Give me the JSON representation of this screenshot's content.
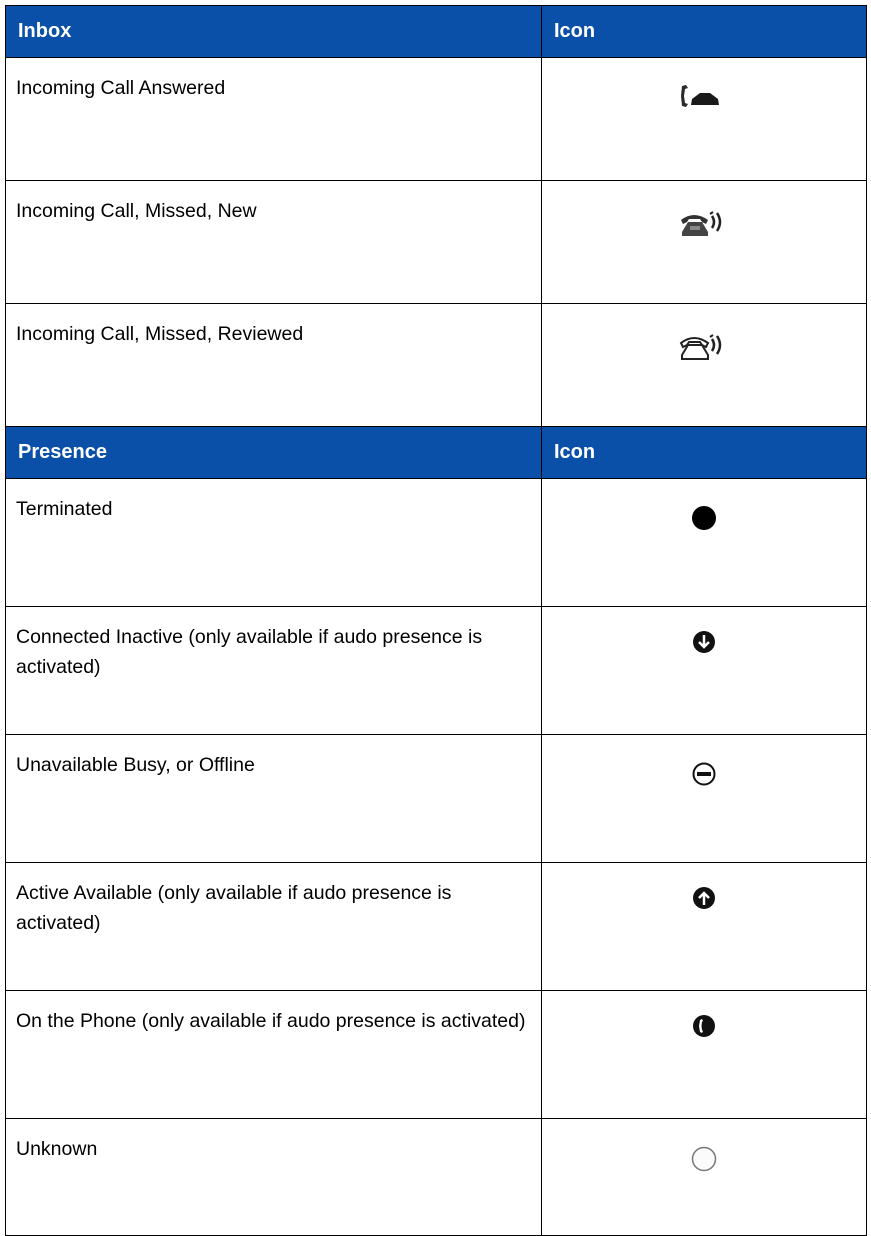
{
  "inbox": {
    "header": {
      "label": "Inbox",
      "icon": "Icon"
    },
    "rows": [
      {
        "label": "Incoming Call Answered",
        "icon": "call-answered-icon"
      },
      {
        "label": "Incoming Call, Missed, New",
        "icon": "call-missed-new-icon"
      },
      {
        "label": "Incoming Call, Missed, Reviewed",
        "icon": "call-missed-reviewed-icon"
      }
    ]
  },
  "presence": {
    "header": {
      "label": "Presence",
      "icon": "Icon"
    },
    "rows": [
      {
        "label": "Terminated",
        "icon": "terminated-icon"
      },
      {
        "label": "Connected Inactive (only available if audo presence is activated)",
        "icon": "connected-inactive-icon"
      },
      {
        "label": "Unavailable Busy, or Offline",
        "icon": "unavailable-busy-icon"
      },
      {
        "label": "Active Available  (only available if audo presence is activated)",
        "icon": "active-available-icon"
      },
      {
        "label": "On the Phone  (only available if audo presence is activated)",
        "icon": "on-the-phone-icon"
      },
      {
        "label": "Unknown",
        "icon": "unknown-icon"
      }
    ]
  },
  "colors": {
    "header_bg": "#0a50a8",
    "header_text": "#ffffff",
    "border": "#000000"
  }
}
